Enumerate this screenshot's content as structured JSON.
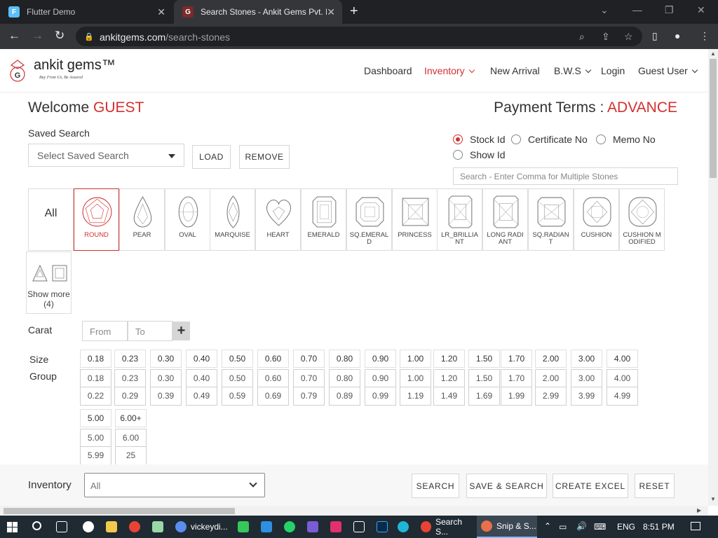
{
  "browser": {
    "tabs": [
      {
        "title": "Flutter Demo",
        "icon": "flutter-icon"
      },
      {
        "title": "Search Stones - Ankit Gems Pvt. L",
        "icon": "ankit-gems-favicon"
      }
    ],
    "new_tab": "+",
    "url_domain": "ankitgems.com",
    "url_path": "/search-stones"
  },
  "site": {
    "logo_name": "ankit gems™",
    "logo_tagline": "Buy From Us, Be Assured",
    "nav": {
      "dashboard": "Dashboard",
      "inventory": "Inventory",
      "new_arrival": "New Arrival",
      "bws": "B.W.S",
      "login": "Login",
      "guest_user": "Guest User"
    }
  },
  "page": {
    "welcome_prefix": "Welcome",
    "welcome_user": "GUEST",
    "payment_prefix": "Payment Terms :",
    "payment_value": "ADVANCE",
    "saved_search_label": "Saved Search",
    "saved_search_placeholder": "Select Saved Search",
    "load_button": "LOAD",
    "remove_button": "REMOVE",
    "radios": {
      "stock_id": "Stock Id",
      "certificate_no": "Certificate No",
      "memo_no": "Memo No",
      "show_id": "Show Id"
    },
    "stone_search_placeholder": "Search - Enter Comma for Multiple Stones",
    "all_label": "All",
    "shapes": [
      "ROUND",
      "PEAR",
      "OVAL",
      "MARQUISE",
      "HEART",
      "EMERALD",
      "SQ.EMERALD",
      "PRINCESS",
      "LR_BRILLIANT",
      "LONG RADIANT",
      "SQ.RADIANT",
      "CUSHION",
      "CUSHION MODIFIED"
    ],
    "selected_shape": "ROUND",
    "show_more": "Show more (4)",
    "carat_label": "Carat",
    "carat_from": "From",
    "carat_to": "To",
    "carat_add": "+",
    "size_label_1": "Size",
    "size_label_2": "Group",
    "size_groups": [
      {
        "head": "0.18",
        "from": "0.18",
        "to": "0.22"
      },
      {
        "head": "0.23",
        "from": "0.23",
        "to": "0.29"
      },
      {
        "head": "0.30",
        "from": "0.30",
        "to": "0.39"
      },
      {
        "head": "0.40",
        "from": "0.40",
        "to": "0.49"
      },
      {
        "head": "0.50",
        "from": "0.50",
        "to": "0.59"
      },
      {
        "head": "0.60",
        "from": "0.60",
        "to": "0.69"
      },
      {
        "head": "0.70",
        "from": "0.70",
        "to": "0.79"
      },
      {
        "head": "0.80",
        "from": "0.80",
        "to": "0.89"
      },
      {
        "head": "0.90",
        "from": "0.90",
        "to": "0.99"
      },
      {
        "head": "1.00",
        "from": "1.00",
        "to": "1.19"
      },
      {
        "head": "1.20",
        "from": "1.20",
        "to": "1.49"
      },
      {
        "head": "1.50",
        "from": "1.50",
        "to": "1.69"
      },
      {
        "head": "1.70",
        "from": "1.70",
        "to": "1.99"
      },
      {
        "head": "2.00",
        "from": "2.00",
        "to": "2.99"
      },
      {
        "head": "3.00",
        "from": "3.00",
        "to": "3.99"
      },
      {
        "head": "4.00",
        "from": "4.00",
        "to": "4.99"
      },
      {
        "head": "5.00",
        "from": "5.00",
        "to": "5.99"
      },
      {
        "head": "6.00+",
        "from": "6.00",
        "to": "25"
      }
    ]
  },
  "bottom": {
    "inventory_label": "Inventory",
    "inventory_value": "All",
    "search": "SEARCH",
    "save_search": "SAVE & SEARCH",
    "create_excel": "CREATE EXCEL",
    "reset": "RESET"
  },
  "taskbar": {
    "apps": [
      "vickeydi...",
      "Search S...",
      "Snip & S..."
    ],
    "lang": "ENG",
    "time": "8:51 PM"
  },
  "colors": {
    "accent": "#d32f2f",
    "chrome_dark": "#202124",
    "taskbar": "#1f2a33"
  }
}
